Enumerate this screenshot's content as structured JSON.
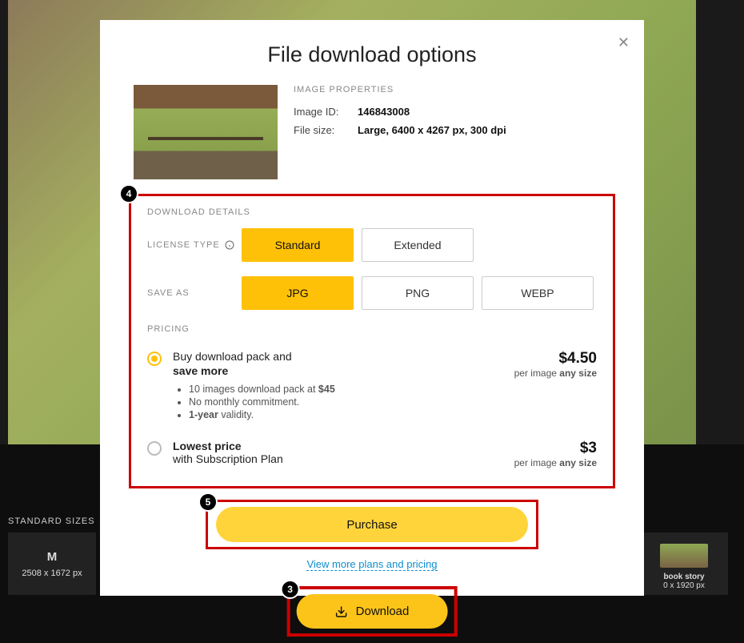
{
  "modal": {
    "title": "File download options",
    "properties_header": "IMAGE PROPERTIES",
    "image_id_label": "Image ID:",
    "image_id_value": "146843008",
    "file_size_label": "File size:",
    "file_size_value": "Large, 6400 x 4267 px, 300 dpi",
    "details_header": "DOWNLOAD DETAILS",
    "license_label": "LICENSE TYPE",
    "license_options": {
      "standard": "Standard",
      "extended": "Extended"
    },
    "saveas_label": "SAVE AS",
    "format_options": {
      "jpg": "JPG",
      "png": "PNG",
      "webp": "WEBP"
    },
    "pricing_header": "PRICING",
    "pack": {
      "line1": "Buy download pack and",
      "line2": "save more",
      "bullet1_a": "10 images download pack at ",
      "bullet1_b": "$45",
      "bullet2": "No monthly commitment.",
      "bullet3_a": "1-year",
      "bullet3_b": " validity.",
      "price": "$4.50",
      "per_a": "per image ",
      "per_b": "any size"
    },
    "sub": {
      "line1": "Lowest price",
      "line2": "with Subscription Plan",
      "price": "$3",
      "per_a": "per image ",
      "per_b": "any size"
    },
    "purchase_label": "Purchase",
    "view_more": "View more plans and pricing"
  },
  "bottom": {
    "download_label": "Download",
    "standard_sizes_label": "STANDARD SIZES",
    "size_m_name": "M",
    "size_m_dims": "2508 x 1672 px",
    "right_label": "book story",
    "right_dims": "0 x 1920 px"
  },
  "callouts": {
    "c3": "3",
    "c4": "4",
    "c5": "5"
  }
}
